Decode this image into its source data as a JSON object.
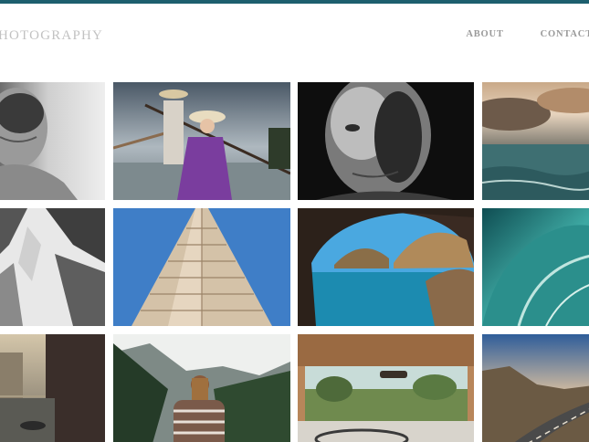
{
  "site": {
    "brand": "HOTOGRAPHY",
    "accent_color": "#1d5f6e"
  },
  "nav": {
    "items": [
      {
        "label": "ABOUT"
      },
      {
        "label": "CONTACT"
      }
    ]
  }
}
